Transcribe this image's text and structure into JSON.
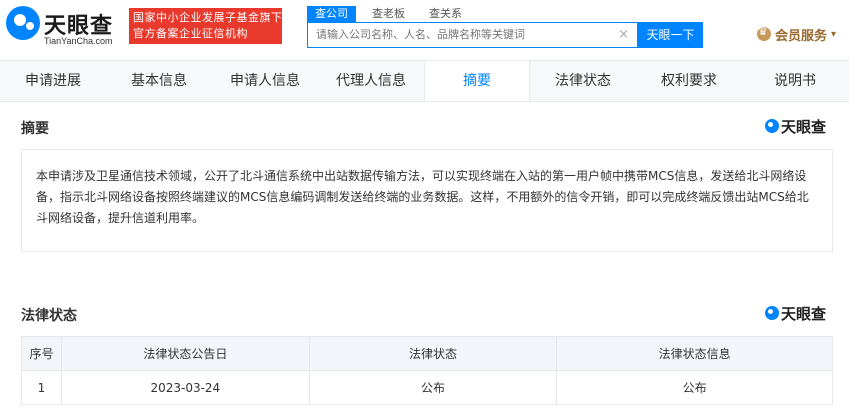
{
  "header": {
    "logo_text": "天眼查",
    "logo_sub": "TianYanCha.com",
    "banner_line1": "国家中小企业发展子基金旗下",
    "banner_line2": "官方备案企业征信机构",
    "search_tabs": [
      "查公司",
      "查老板",
      "查关系"
    ],
    "search_placeholder": "请输入公司名称、人名、品牌名称等关键词",
    "search_button": "天眼一下",
    "member_label": "会员服务"
  },
  "tabs": [
    "申请进展",
    "基本信息",
    "申请人信息",
    "代理人信息",
    "摘要",
    "法律状态",
    "权利要求",
    "说明书"
  ],
  "active_tab": 4,
  "abstract": {
    "title": "摘要",
    "watermark": "天眼查",
    "text": "本申请涉及卫星通信技术领域，公开了北斗通信系统中出站数据传输方法，可以实现终端在入站的第一用户帧中携带MCS信息，发送给北斗网络设备，指示北斗网络设备按照终端建议的MCS信息编码调制发送给终端的业务数据。这样，不用额外的信令开销，即可以完成终端反馈出站MCS给北斗网络设备，提升信道利用率。"
  },
  "legal": {
    "title": "法律状态",
    "watermark": "天眼查",
    "columns": [
      "序号",
      "法律状态公告日",
      "法律状态",
      "法律状态信息"
    ],
    "rows": [
      [
        "1",
        "2023-03-24",
        "公布",
        "公布"
      ]
    ]
  },
  "colors": {
    "accent": "#0084ff",
    "banner": "#e8392c",
    "member": "#9a6a2f"
  }
}
